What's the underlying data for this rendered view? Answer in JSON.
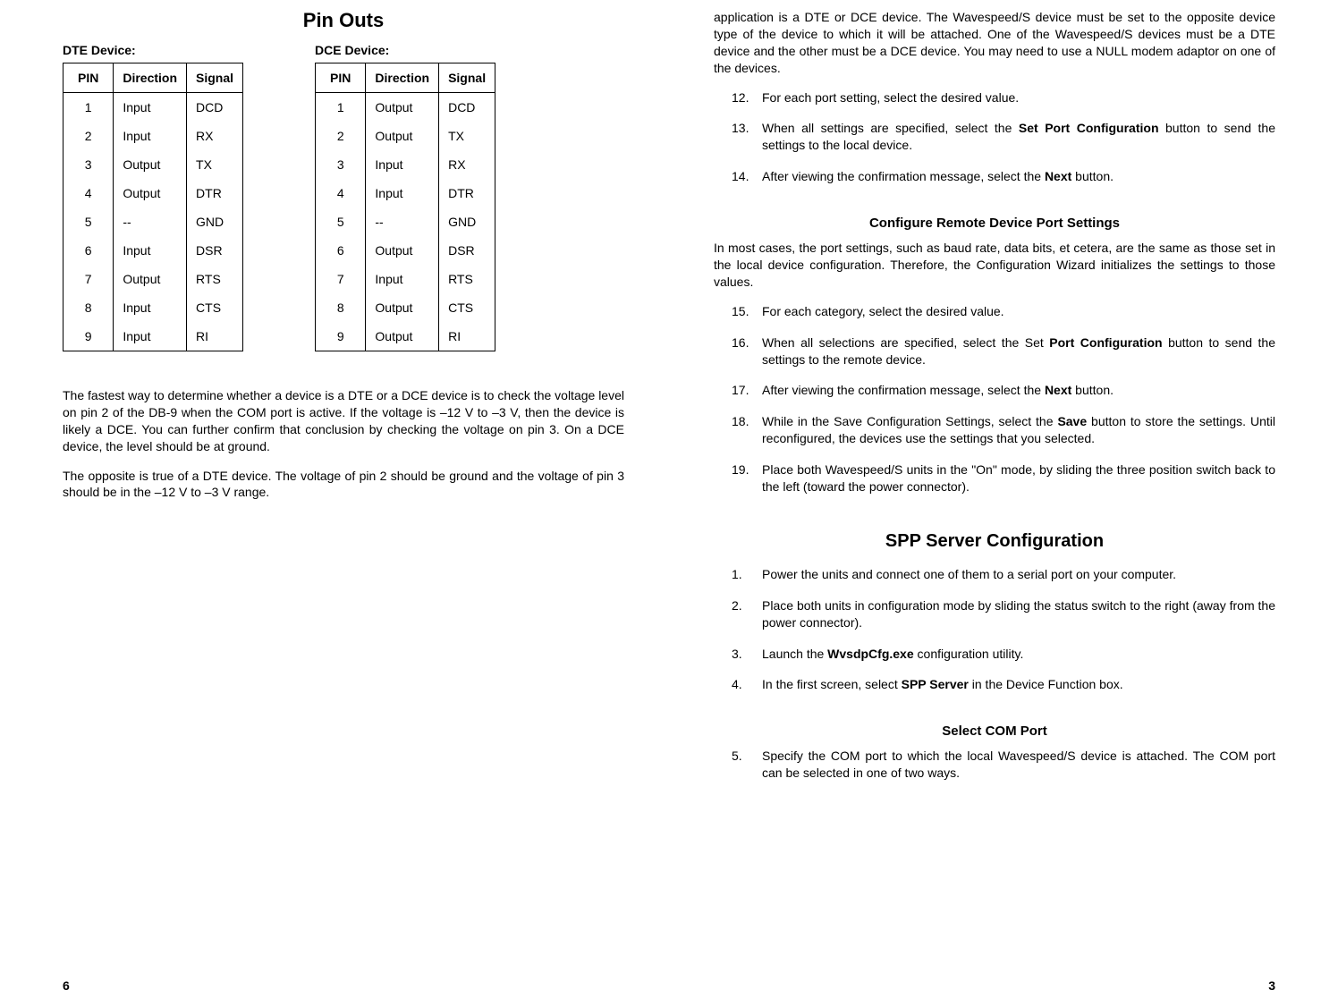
{
  "leftPage": {
    "title": "Pin Outs",
    "dteLabel": "DTE Device:",
    "dceLabel": "DCE Device:",
    "headers": {
      "pin": "PIN",
      "direction": "Direction",
      "signal": "Signal"
    },
    "dteRows": [
      {
        "pin": "1",
        "dir": "Input",
        "sig": "DCD"
      },
      {
        "pin": "2",
        "dir": "Input",
        "sig": "RX"
      },
      {
        "pin": "3",
        "dir": "Output",
        "sig": "TX"
      },
      {
        "pin": "4",
        "dir": "Output",
        "sig": "DTR"
      },
      {
        "pin": "5",
        "dir": "--",
        "sig": "GND"
      },
      {
        "pin": "6",
        "dir": "Input",
        "sig": "DSR"
      },
      {
        "pin": "7",
        "dir": "Output",
        "sig": "RTS"
      },
      {
        "pin": "8",
        "dir": "Input",
        "sig": "CTS"
      },
      {
        "pin": "9",
        "dir": "Input",
        "sig": "RI"
      }
    ],
    "dceRows": [
      {
        "pin": "1",
        "dir": "Output",
        "sig": "DCD"
      },
      {
        "pin": "2",
        "dir": "Output",
        "sig": "TX"
      },
      {
        "pin": "3",
        "dir": "Input",
        "sig": "RX"
      },
      {
        "pin": "4",
        "dir": "Input",
        "sig": "DTR"
      },
      {
        "pin": "5",
        "dir": "--",
        "sig": "GND"
      },
      {
        "pin": "6",
        "dir": "Output",
        "sig": "DSR"
      },
      {
        "pin": "7",
        "dir": "Input",
        "sig": "RTS"
      },
      {
        "pin": "8",
        "dir": "Output",
        "sig": "CTS"
      },
      {
        "pin": "9",
        "dir": "Output",
        "sig": "RI"
      }
    ],
    "para1": "The fastest way to determine whether a device is a DTE or a DCE device is to check the voltage level on pin 2 of the DB-9 when the COM port is active.  If the voltage is –12 V to –3 V, then the device is likely a DCE. You can further confirm that conclusion by checking the voltage on pin 3. On a DCE device, the level should be at ground.",
    "para2": "The opposite is true of a DTE device. The voltage of pin 2 should be ground and the voltage of pin 3 should be in the –12 V to –3 V range.",
    "pageNum": "6"
  },
  "rightPage": {
    "introPara": "application is a DTE or DCE device. The Wavespeed/S device must be set to the opposite device type of the device to which it will be attached. One of the Wavespeed/S devices must be a DTE device and the other must be a DCE device. You may need to use a NULL modem adaptor on one of the devices.",
    "steps12to14": [
      {
        "n": "12.",
        "plain": "For each port setting, select the desired value."
      },
      {
        "n": "13.",
        "pre": "When all settings are specified, select the ",
        "bold": "Set Port Configuration",
        "post": " button to send the settings to the local device."
      },
      {
        "n": "14.",
        "pre": "After viewing the confirmation message, select the ",
        "bold": "Next",
        "post": " button."
      }
    ],
    "remoteHeading": "Configure Remote Device Port Settings",
    "remotePara": "In most cases, the port settings, such as baud rate, data bits, et cetera, are the same as those set in the local device configuration. Therefore, the Configuration Wizard initializes the settings to those values.",
    "steps15to19": [
      {
        "n": "15.",
        "plain": "For each category, select the desired value."
      },
      {
        "n": "16.",
        "pre": "When all selections are specified, select the Set ",
        "bold": "Port Configuration",
        "post": " button to send the settings to the remote device."
      },
      {
        "n": "17.",
        "pre": "After viewing the confirmation message, select the ",
        "bold": "Next",
        "post": " button."
      },
      {
        "n": "18.",
        "pre": "While in the Save Configuration Settings, select the ",
        "bold": "Save",
        "post": " button to store the settings. Until reconfigured, the devices use the settings that you selected."
      },
      {
        "n": "19.",
        "plain": "Place both Wavespeed/S units in the \"On\" mode, by sliding the three position switch back to the left (toward the power connector)."
      }
    ],
    "sppHeading": "SPP Server Configuration",
    "sppSteps": [
      {
        "n": "1.",
        "plain": "Power the units and connect one of them to a serial port on your computer."
      },
      {
        "n": "2.",
        "plain": "Place both units in configuration mode by sliding the status switch to the right (away from the power connector)."
      },
      {
        "n": "3.",
        "pre": "Launch the ",
        "bold": "WvsdpCfg.exe",
        "post": " configuration utility."
      },
      {
        "n": "4.",
        "pre": "In the first screen, select ",
        "bold": "SPP Server",
        "post": " in the Device Function box."
      }
    ],
    "comHeading": "Select COM Port",
    "comSteps": [
      {
        "n": "5.",
        "plain": "Specify the COM port to which the local Wavespeed/S device is attached. The COM port can be selected in one of two ways."
      }
    ],
    "pageNum": "3"
  }
}
